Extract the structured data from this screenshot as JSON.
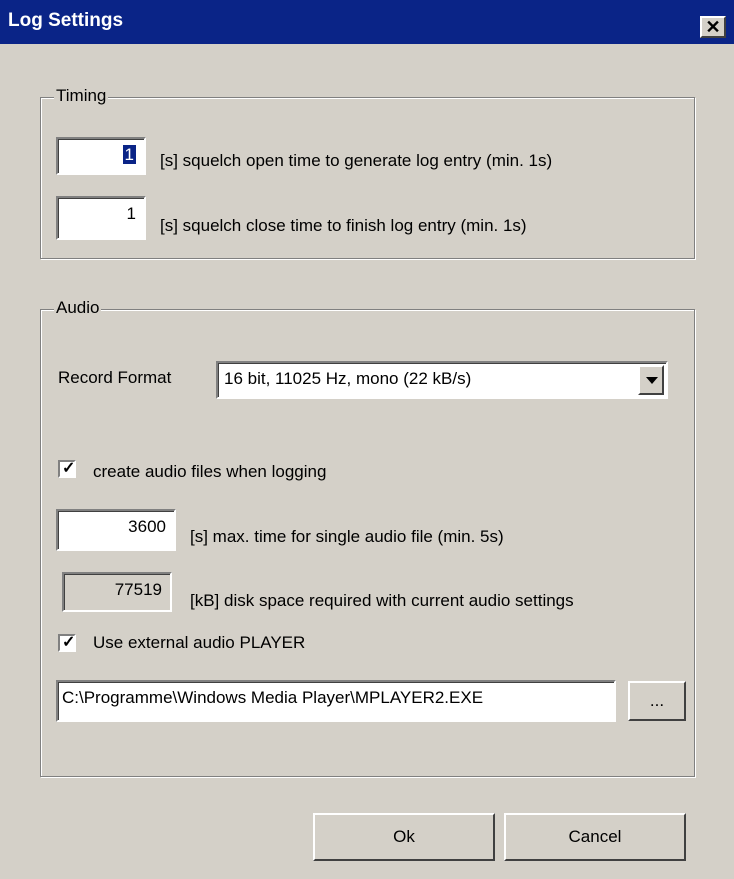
{
  "window": {
    "title": "Log Settings",
    "close_label": "✕"
  },
  "timing": {
    "legend": "Timing",
    "open_value": "1",
    "open_label": "[s] squelch open time to generate log entry (min. 1s)",
    "close_value": "1",
    "close_label": "[s] squelch close time to finish log entry (min. 1s)"
  },
  "audio": {
    "legend": "Audio",
    "record_format_label": "Record Format",
    "record_format_value": "16 bit, 11025 Hz, mono (22 kB/s)",
    "create_files_checked": true,
    "create_files_label": "create audio files when logging",
    "max_time_value": "3600",
    "max_time_label": "[s] max. time for single audio file (min. 5s)",
    "disk_space_value": "77519",
    "disk_space_label": "[kB] disk space required with current audio settings",
    "external_player_checked": true,
    "external_player_label": "Use external audio PLAYER",
    "player_path": "C:\\Programme\\Windows Media Player\\MPLAYER2.EXE",
    "browse_label": "..."
  },
  "buttons": {
    "ok": "Ok",
    "cancel": "Cancel"
  }
}
